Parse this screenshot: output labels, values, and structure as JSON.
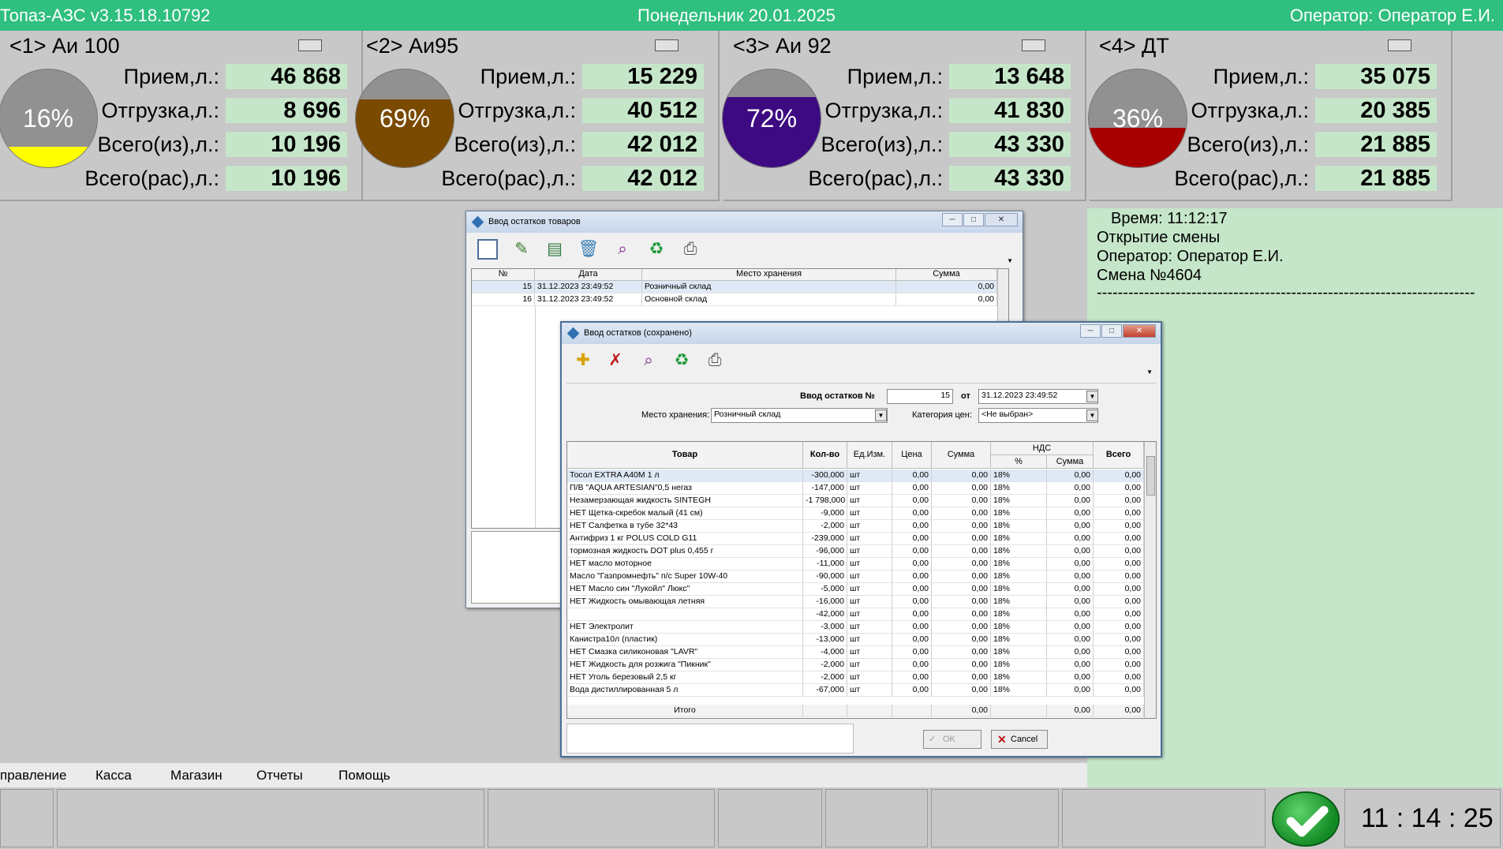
{
  "topbar": {
    "app": "Топаз-АЗС  v3.15.18.10792",
    "date": "Понедельник 20.01.2025",
    "operator": "Оператор: Оператор Е.И."
  },
  "labels": {
    "priem": "Прием,л.:",
    "otgr": "Отгрузка,л.:",
    "vsego_iz": "Всего(из),л.:",
    "vsego_ras": "Всего(рас),л.:"
  },
  "tanks": [
    {
      "title": "<1> Аи 100",
      "pct_label": "16%",
      "level": 0.21,
      "color": "#ffff00",
      "priem": "46 868",
      "otgr": "8 696",
      "vsego_iz": "10 196",
      "vsego_ras": "10 196"
    },
    {
      "title": "<2> Аи95",
      "pct_label": "69%",
      "level": 0.69,
      "color": "#7a4a00",
      "priem": "15 229",
      "otgr": "40 512",
      "vsego_iz": "42 012",
      "vsego_ras": "42 012"
    },
    {
      "title": "<3> Аи 92",
      "pct_label": "72%",
      "level": 0.72,
      "color": "#3d0a82",
      "priem": "13 648",
      "otgr": "41 830",
      "vsego_iz": "43 330",
      "vsego_ras": "43 330"
    },
    {
      "title": "<4> ДТ",
      "pct_label": "36%",
      "level": 0.4,
      "color": "#a80000",
      "priem": "35 075",
      "otgr": "20 385",
      "vsego_iz": "21 885",
      "vsego_ras": "21 885"
    }
  ],
  "log": {
    "time": "Время: 11:12:17",
    "line1": "Открытие смены",
    "line2": "Оператор: Оператор Е.И.",
    "line3": "Смена №4604",
    "sep": "------------------------------------------------------------------------"
  },
  "menu": {
    "m1": "правление",
    "m2": "Касса",
    "m3": "Магазин",
    "m4": "Отчеты",
    "m5": "Помощь"
  },
  "clock": "11 : 14 : 25",
  "win1": {
    "title": "Ввод остатков товаров",
    "cols": {
      "n": "№",
      "date": "Дата",
      "place": "Место хранения",
      "sum": "Сумма"
    },
    "rows": [
      {
        "n": "15",
        "date": "31.12.2023 23:49:52",
        "place": "Розничный склад",
        "sum": "0,00"
      },
      {
        "n": "16",
        "date": "31.12.2023 23:49:52",
        "place": "Основной склад",
        "sum": "0,00"
      }
    ]
  },
  "win2": {
    "title": "Ввод остатков (сохранено)",
    "doc_label": "Ввод остатков №",
    "doc_no": "15",
    "ot_label": "от",
    "doc_date": "31.12.2023 23:49:52",
    "place_label": "Место хранения:",
    "place": "Розничный склад",
    "cat_label": "Категория цен:",
    "cat": "<Не выбран>",
    "cols": {
      "tovar": "Товар",
      "kol": "Кол-во",
      "ed": "Ед.Изм.",
      "price": "Цена",
      "sum": "Сумма",
      "nds": "НДС",
      "nds_pct": "%",
      "nds_sum": "Сумма",
      "total": "Всего"
    },
    "zero": "0,00",
    "rows": [
      {
        "name": "Тосол  EXTRA A40M 1 л",
        "qty": "-300,000",
        "unit": "шт",
        "pct": "18%"
      },
      {
        "name": "П/В \"AQUA ARTESIAN\"0,5 негаз",
        "qty": "-147,000",
        "unit": "шт",
        "pct": "18%"
      },
      {
        "name": "Незамерзающая жидкость SINTEGH",
        "qty": "-1 798,000",
        "unit": "шт",
        "pct": "18%"
      },
      {
        "name": "НЕТ Щетка-скребок малый (41 см)",
        "qty": "-9,000",
        "unit": "шт",
        "pct": "18%"
      },
      {
        "name": "НЕТ Салфетка в тубе 32*43",
        "qty": "-2,000",
        "unit": "шт",
        "pct": "18%"
      },
      {
        "name": " Антифриз 1 кг POLUS COLD G11",
        "qty": "-239,000",
        "unit": "шт",
        "pct": "18%"
      },
      {
        "name": "тормозная жидкость DOT plus 0,455 г",
        "qty": "-96,000",
        "unit": "шт",
        "pct": "18%"
      },
      {
        "name": "НЕТ масло моторное",
        "qty": "-11,000",
        "unit": "шт",
        "pct": "18%"
      },
      {
        "name": "Масло \"Газпромнефть\" п/с  Super 10W-40",
        "qty": "-90,000",
        "unit": "шт",
        "pct": "18%"
      },
      {
        "name": "НЕТ Масло син  \"Лукойл\" Люкс\"",
        "qty": "-5,000",
        "unit": "шт",
        "pct": "18%"
      },
      {
        "name": "НЕТ Жидкость омывающая летняя",
        "qty": "-16,000",
        "unit": "шт",
        "pct": "18%"
      },
      {
        "name": "",
        "qty": "-42,000",
        "unit": "шт",
        "pct": "18%"
      },
      {
        "name": "НЕТ Электролит",
        "qty": "-3,000",
        "unit": "шт",
        "pct": "18%"
      },
      {
        "name": " Канистра10л (пластик)",
        "qty": "-13,000",
        "unit": "шт",
        "pct": "18%"
      },
      {
        "name": "НЕТ Смазка силиконовая \"LAVR\"",
        "qty": "-4,000",
        "unit": "шт",
        "pct": "18%"
      },
      {
        "name": "НЕТ Жидкость для розжига \"Пикник\"",
        "qty": "-2,000",
        "unit": "шт",
        "pct": "18%"
      },
      {
        "name": "НЕТ Уголь березовый 2,5 кг",
        "qty": "-2,000",
        "unit": "шт",
        "pct": "18%"
      },
      {
        "name": "Вода дистиллированная 5 л",
        "qty": "-67,000",
        "unit": "шт",
        "pct": "18%"
      }
    ],
    "itogo": "Итого",
    "ok": "OK",
    "cancel": "Cancel"
  }
}
